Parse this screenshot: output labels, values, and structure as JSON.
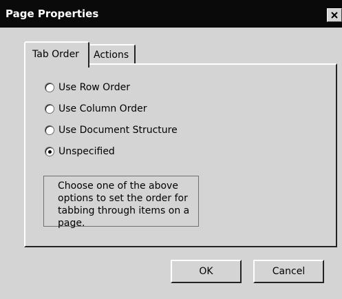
{
  "window": {
    "title": "Page Properties",
    "close_icon": "close-icon"
  },
  "tabs": [
    {
      "label": "Tab Order",
      "selected": true
    },
    {
      "label": "Actions",
      "selected": false
    }
  ],
  "tab_order": {
    "options": [
      {
        "label": "Use Row Order",
        "selected": false
      },
      {
        "label": "Use Column Order",
        "selected": false
      },
      {
        "label": "Use Document Structure",
        "selected": false
      },
      {
        "label": "Unspecified",
        "selected": true
      }
    ],
    "description": "Choose one of the above options to set the order for tabbing through items on a page."
  },
  "buttons": {
    "ok_label": "OK",
    "cancel_label": "Cancel"
  },
  "colors": {
    "titlebar_background": "#0a0a0a",
    "dialog_background": "#d4d4d4"
  }
}
